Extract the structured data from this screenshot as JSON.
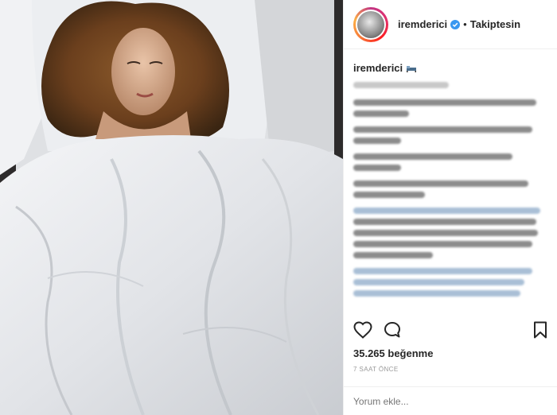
{
  "post": {
    "username": "iremderici",
    "follow_label": "Takiptesin",
    "caption_author": "iremderici",
    "likes_text": "35.265 beğenme",
    "time_text": "7 SAAT ÖNCE",
    "comment_placeholder": "Yorum ekle..."
  },
  "colors": {
    "accent_blue": "#3897f0",
    "text": "#262626",
    "muted": "#999999",
    "border": "#efefef"
  },
  "icons": {
    "verified": "verified-badge-icon",
    "like": "heart-icon",
    "comment": "comment-bubble-icon",
    "save": "bookmark-icon",
    "caption_emoji": "bed-emoji-icon"
  }
}
